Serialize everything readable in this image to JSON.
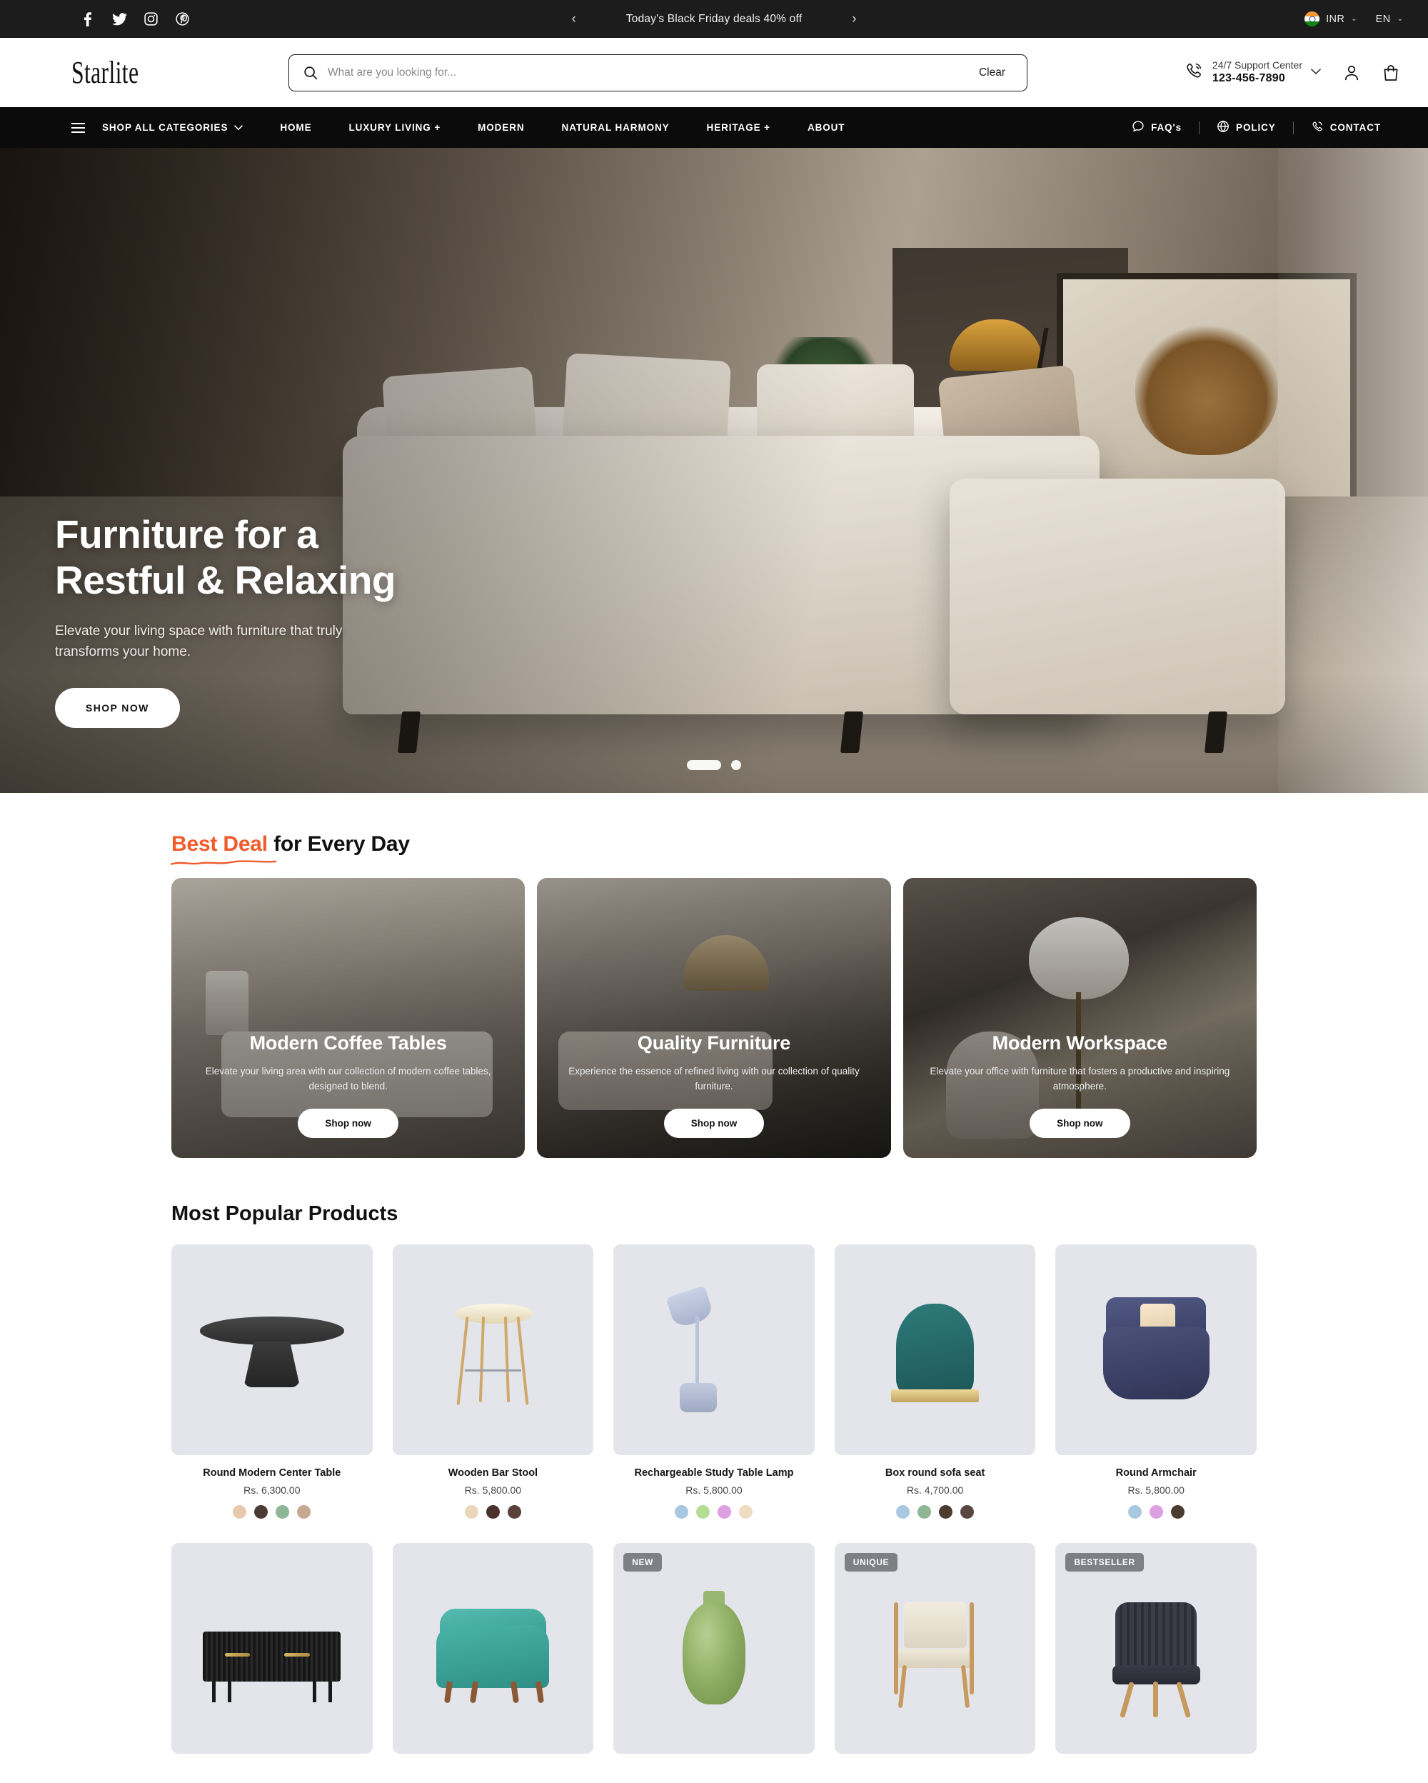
{
  "topbar": {
    "social": [
      {
        "name": "facebook-icon",
        "glyph": "f"
      },
      {
        "name": "twitter-icon",
        "glyph": "🐦"
      },
      {
        "name": "instagram-icon",
        "glyph": "▣"
      },
      {
        "name": "pinterest-icon",
        "glyph": "Ⓟ"
      }
    ],
    "prev_label": "‹",
    "next_label": "›",
    "announcement": "Today's Black Friday deals 40% off",
    "currency": "INR",
    "language": "EN",
    "caret": "⌄"
  },
  "header": {
    "logo": "Starlite",
    "search_placeholder": "What are you looking for...",
    "search_value": "",
    "clear_label": "Clear",
    "support_label": "24/7 Support Center",
    "support_phone": "123-456-7890"
  },
  "nav": {
    "categories_label": "SHOP ALL CATEGORIES",
    "items": [
      {
        "label": "HOME"
      },
      {
        "label": "LUXURY LIVING +"
      },
      {
        "label": "MODERN"
      },
      {
        "label": "NATURAL HARMONY"
      },
      {
        "label": "HERITAGE +"
      },
      {
        "label": "ABOUT"
      }
    ],
    "right_links": [
      {
        "label": "FAQ's",
        "icon": "chat-icon"
      },
      {
        "label": "POLICY",
        "icon": "globe-icon"
      },
      {
        "label": "CONTACT",
        "icon": "phone-icon"
      }
    ]
  },
  "hero": {
    "title_line1": "Furniture for a",
    "title_line2": "Restful & Relaxing",
    "subtitle": "Elevate your living space with furniture that truly transforms your home.",
    "cta": "SHOP NOW",
    "slides": 2,
    "active_slide": 1
  },
  "best_deal": {
    "heading_accent": "Best Deal",
    "heading_rest": " for Every Day",
    "accent_color": "#f15a29",
    "cards": [
      {
        "title": "Modern Coffee Tables",
        "desc": "Elevate your living area with our collection of modern coffee tables, designed to blend.",
        "cta": "Shop now"
      },
      {
        "title": "Quality Furniture",
        "desc": "Experience the essence of refined living with our collection of quality furniture.",
        "cta": "Shop now"
      },
      {
        "title": "Modern Workspace",
        "desc": "Elevate your office with furniture that fosters a productive and inspiring atmosphere.",
        "cta": "Shop now"
      }
    ]
  },
  "products": {
    "heading": "Most Popular Products",
    "row1": [
      {
        "name": "Round Modern Center Table",
        "price": "Rs. 6,300.00",
        "badge": "",
        "swatches": [
          "#e8c9ad",
          "#4b3b31",
          "#8fb694",
          "#c6a98e"
        ]
      },
      {
        "name": "Wooden Bar Stool",
        "price": "Rs. 5,800.00",
        "badge": "",
        "swatches": [
          "#ecd6bb",
          "#4a312a",
          "#5a423a"
        ]
      },
      {
        "name": "Rechargeable Study Table Lamp",
        "price": "Rs. 5,800.00",
        "badge": "",
        "swatches": [
          "#a8c8e0",
          "#b5dc92",
          "#dd9fe0",
          "#eddbc2"
        ]
      },
      {
        "name": "Box round sofa seat",
        "price": "Rs. 4,700.00",
        "badge": "",
        "swatches": [
          "#a8c8e0",
          "#8fb694",
          "#4b3b31",
          "#5a473f"
        ]
      },
      {
        "name": "Round Armchair",
        "price": "Rs. 5,800.00",
        "badge": "",
        "swatches": [
          "#a8c8e0",
          "#dd9fe0",
          "#4b3b31"
        ]
      }
    ],
    "row2": [
      {
        "name": "",
        "price": "",
        "badge": "",
        "swatches": []
      },
      {
        "name": "",
        "price": "",
        "badge": "",
        "swatches": []
      },
      {
        "name": "",
        "price": "",
        "badge": "NEW",
        "swatches": []
      },
      {
        "name": "",
        "price": "",
        "badge": "UNIQUE",
        "swatches": []
      },
      {
        "name": "",
        "price": "",
        "badge": "BESTSELLER",
        "swatches": []
      }
    ]
  }
}
